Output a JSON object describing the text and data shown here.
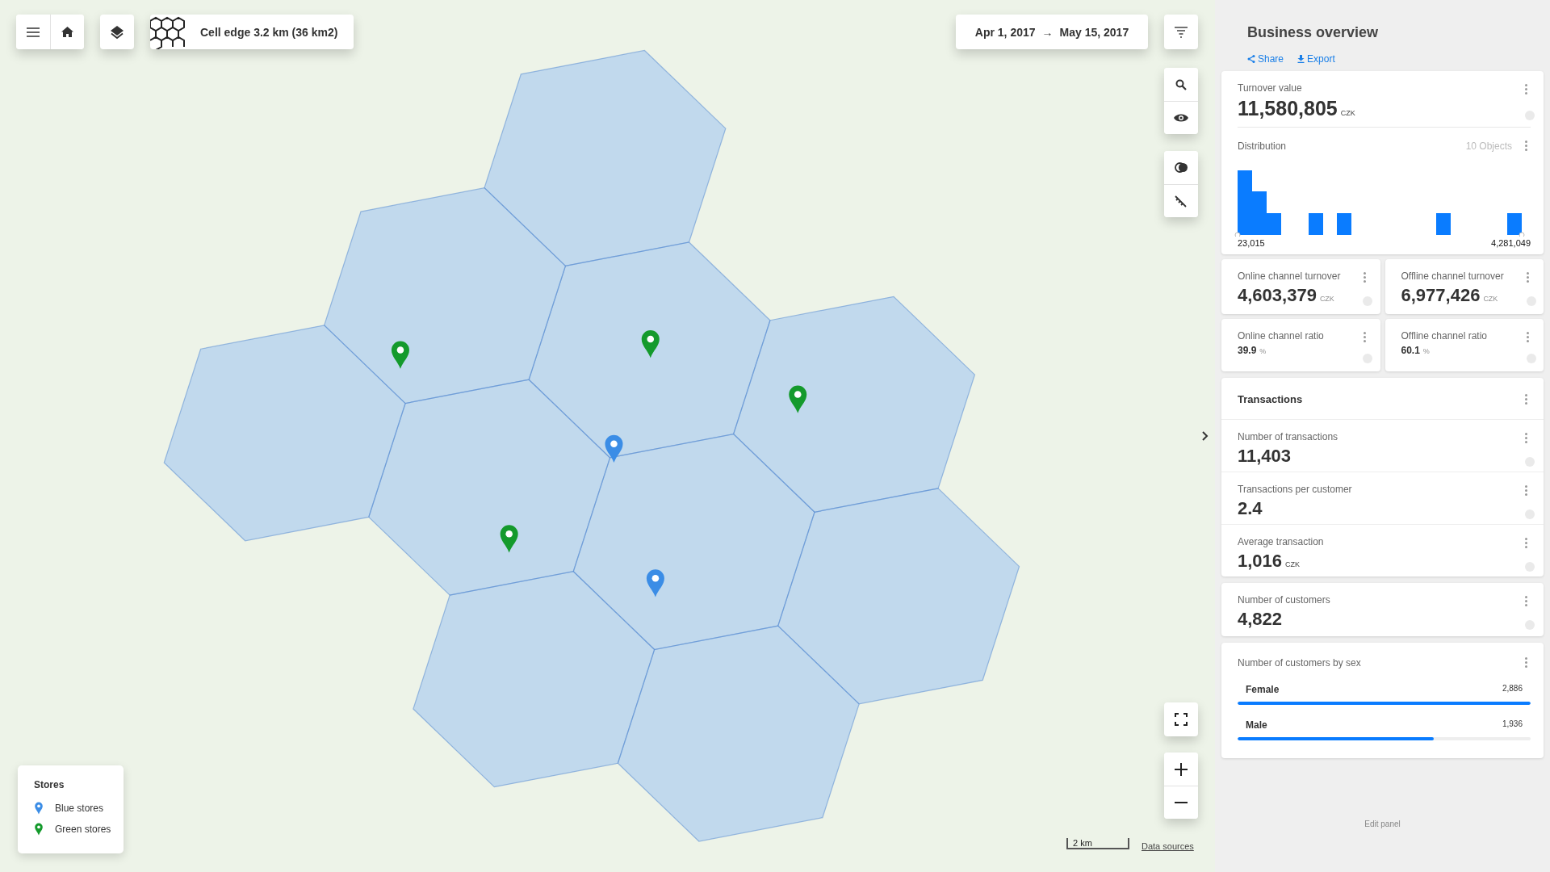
{
  "toolbar": {
    "cell_edge": "Cell edge 3.2 km (36 km2)"
  },
  "date_range": {
    "start": "Apr 1, 2017",
    "arrow": "→",
    "end": "May 15, 2017"
  },
  "map": {
    "stores": [
      {
        "color": "#149a2c"
      },
      {
        "color": "#149a2c"
      },
      {
        "color": "#149a2c"
      },
      {
        "color": "#149a2c"
      },
      {
        "color": "#3b8de6"
      },
      {
        "color": "#3b8de6"
      }
    ],
    "scale": "2 km",
    "data_sources": "Data sources"
  },
  "legend": {
    "title": "Stores",
    "items": [
      {
        "label": "Blue stores",
        "color": "#3b8de6"
      },
      {
        "label": "Green stores",
        "color": "#149a2c"
      }
    ]
  },
  "panel": {
    "title": "Business overview",
    "actions": [
      {
        "label": "Share",
        "kind": "share"
      },
      {
        "label": "Export",
        "kind": "export"
      }
    ],
    "turnover": {
      "label": "Turnover value",
      "value": "11,580,805",
      "unit": "CZK"
    },
    "distribution": {
      "label": "Distribution",
      "count": "10 Objects",
      "min": "23,015",
      "max": "4,281,049"
    },
    "channels": [
      {
        "label": "Online channel turnover",
        "value": "4,603,379",
        "unit": "CZK",
        "kind": "large"
      },
      {
        "label": "Offline channel turnover",
        "value": "6,977,426",
        "unit": "CZK",
        "kind": "large"
      },
      {
        "label": "Online channel ratio",
        "value": "39.9",
        "unit": "%",
        "kind": "small"
      },
      {
        "label": "Offline channel ratio",
        "value": "60.1",
        "unit": "%",
        "kind": "small"
      }
    ],
    "transactions": {
      "title": "Transactions",
      "metrics": [
        {
          "label": "Number of transactions",
          "value": "11,403"
        },
        {
          "label": "Transactions per customer",
          "value": "2.4"
        },
        {
          "label": "Average transaction",
          "value": "1,016",
          "unit": "CZK"
        }
      ]
    },
    "customers": {
      "label": "Number of customers",
      "value": "4,822"
    },
    "by_sex": {
      "label": "Number of customers by sex",
      "groups": [
        {
          "label": "Female",
          "value": "2,886",
          "level": 1.0
        },
        {
          "label": "Male",
          "value": "1,936",
          "level": 0.67
        }
      ]
    },
    "edit_panel": "Edit panel"
  }
}
